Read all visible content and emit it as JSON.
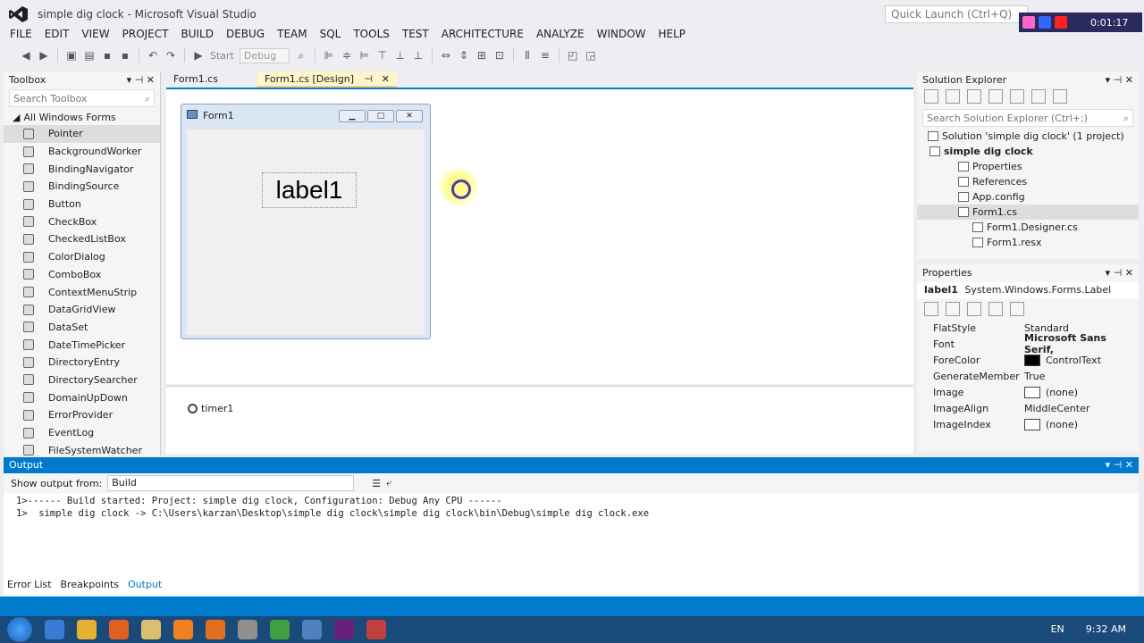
{
  "window": {
    "title": "simple dig clock - Microsoft Visual Studio",
    "quick_launch": "Quick Launch (Ctrl+Q)",
    "recorder_time": "0:01:17"
  },
  "menu": [
    "FILE",
    "EDIT",
    "VIEW",
    "PROJECT",
    "BUILD",
    "DEBUG",
    "TEAM",
    "SQL",
    "TOOLS",
    "TEST",
    "ARCHITECTURE",
    "ANALYZE",
    "WINDOW",
    "HELP"
  ],
  "toolbar": {
    "start_label": "Start",
    "config": "Debug"
  },
  "toolbox": {
    "title": "Toolbox",
    "search": "Search Toolbox",
    "section": "All Windows Forms",
    "items": [
      "Pointer",
      "BackgroundWorker",
      "BindingNavigator",
      "BindingSource",
      "Button",
      "CheckBox",
      "CheckedListBox",
      "ColorDialog",
      "ComboBox",
      "ContextMenuStrip",
      "DataGridView",
      "DataSet",
      "DateTimePicker",
      "DirectoryEntry",
      "DirectorySearcher",
      "DomainUpDown",
      "ErrorProvider",
      "EventLog",
      "FileSystemWatcher"
    ]
  },
  "tabs": [
    {
      "label": "Form1.cs"
    },
    {
      "label": "Form1.cs [Design]"
    }
  ],
  "designer": {
    "form_title": "Form1",
    "label_text": "label1",
    "tray_item": "timer1"
  },
  "solution": {
    "title": "Solution Explorer",
    "search": "Search Solution Explorer (Ctrl+;)",
    "items": [
      "Solution 'simple dig clock' (1 project)",
      "simple dig clock",
      "Properties",
      "References",
      "App.config",
      "Form1.cs",
      "Form1.Designer.cs",
      "Form1.resx"
    ]
  },
  "properties": {
    "title": "Properties",
    "selected_name": "label1",
    "selected_type": "System.Windows.Forms.Label",
    "rows": [
      {
        "name": "FlatStyle",
        "value": "Standard"
      },
      {
        "name": "Font",
        "value": "Microsoft Sans Serif,"
      },
      {
        "name": "ForeColor",
        "value": "ControlText"
      },
      {
        "name": "GenerateMember",
        "value": "True"
      },
      {
        "name": "Image",
        "value": "(none)"
      },
      {
        "name": "ImageAlign",
        "value": "MiddleCenter"
      },
      {
        "name": "ImageIndex",
        "value": "(none)"
      }
    ]
  },
  "output": {
    "title": "Output",
    "show_from_label": "Show output from:",
    "show_from_value": "Build",
    "lines": [
      "1>------ Build started: Project: simple dig clock, Configuration: Debug Any CPU ------",
      "1>  simple dig clock -> C:\\Users\\karzan\\Desktop\\simple dig clock\\simple dig clock\\bin\\Debug\\simple dig clock.exe"
    ]
  },
  "bottom_tabs": [
    "Error List",
    "Breakpoints",
    "Output"
  ],
  "taskbar": {
    "lang": "EN",
    "time": "9:32 AM"
  },
  "colors": {
    "accent": "#007acc",
    "taskbar": "#1a4a7a"
  }
}
